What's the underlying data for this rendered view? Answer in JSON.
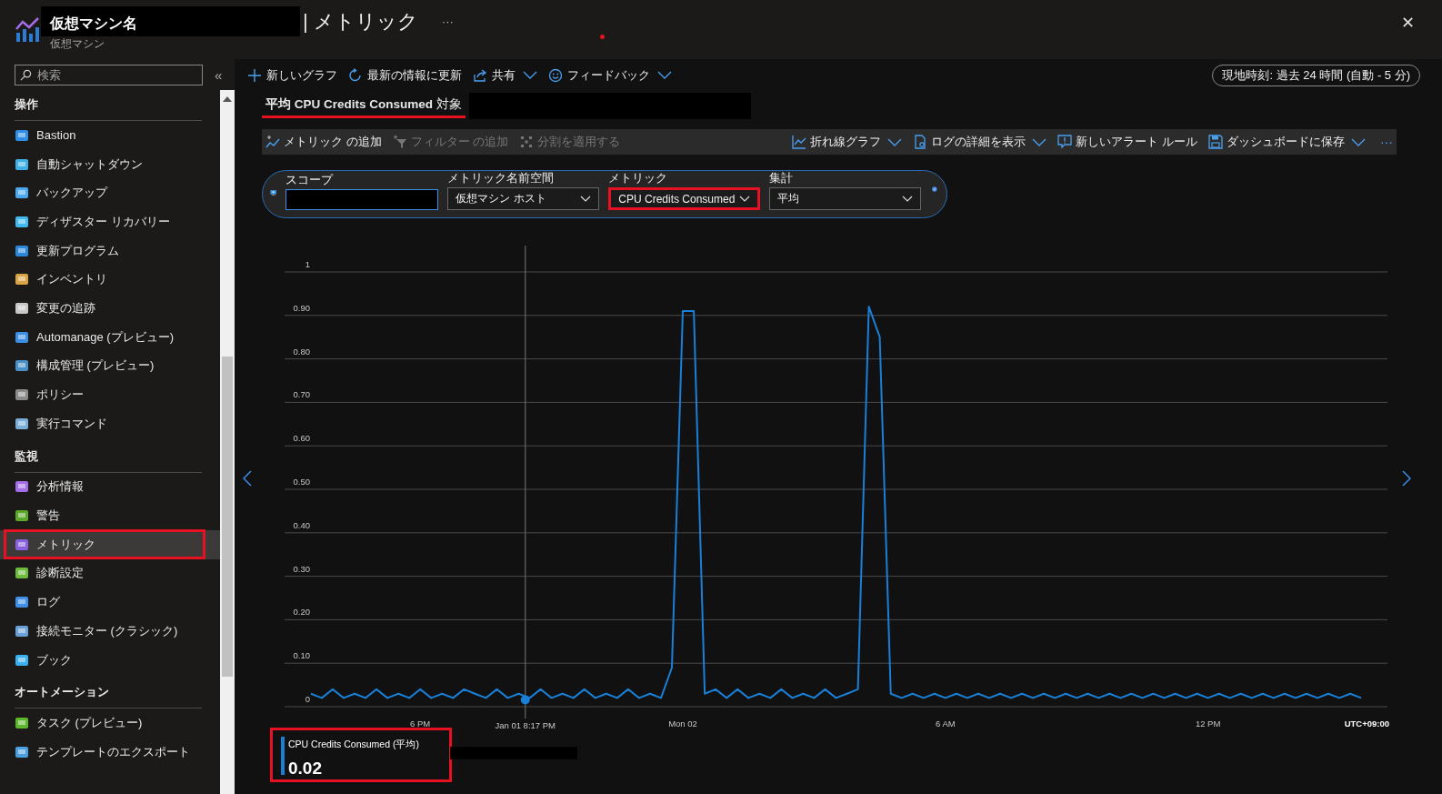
{
  "header": {
    "title": "仮想マシン名",
    "page": "| メトリック",
    "more": "···",
    "subtitle": "仮想マシン",
    "close": "✕"
  },
  "sidebar": {
    "search": {
      "placeholder": "検索"
    },
    "collapse": "«",
    "sections": [
      {
        "title": "操作",
        "items": [
          {
            "label": "Bastion",
            "selected": false
          },
          {
            "label": "自動シャットダウン",
            "selected": false
          },
          {
            "label": "バックアップ",
            "selected": false
          },
          {
            "label": "ディザスター リカバリー",
            "selected": false
          },
          {
            "label": "更新プログラム",
            "selected": false
          },
          {
            "label": "インベントリ",
            "selected": false
          },
          {
            "label": "変更の追跡",
            "selected": false
          },
          {
            "label": "Automanage (プレビュー)",
            "selected": false
          },
          {
            "label": "構成管理 (プレビュー)",
            "selected": false
          },
          {
            "label": "ポリシー",
            "selected": false
          },
          {
            "label": "実行コマンド",
            "selected": false
          }
        ]
      },
      {
        "title": "監視",
        "items": [
          {
            "label": "分析情報",
            "selected": false
          },
          {
            "label": "警告",
            "selected": false
          },
          {
            "label": "メトリック",
            "selected": true,
            "highlighted": true
          },
          {
            "label": "診断設定",
            "selected": false
          },
          {
            "label": "ログ",
            "selected": false
          },
          {
            "label": "接続モニター (クラシック)",
            "selected": false
          },
          {
            "label": "ブック",
            "selected": false
          }
        ]
      },
      {
        "title": "オートメーション",
        "items": [
          {
            "label": "タスク (プレビュー)",
            "selected": false
          },
          {
            "label": "テンプレートのエクスポート",
            "selected": false
          }
        ]
      }
    ]
  },
  "toolbar": {
    "buttons": [
      {
        "label": "新しいグラフ",
        "dropdown": false
      },
      {
        "label": "最新の情報に更新",
        "dropdown": false
      },
      {
        "label": "共有",
        "dropdown": true
      },
      {
        "label": "フィードバック",
        "dropdown": true
      }
    ],
    "time_range": "現地時刻: 過去 24 時間 (自動 - 5 分)"
  },
  "chart_title": {
    "text": "**平均 CPU Credits Consumed** 対象",
    "underlined": true
  },
  "chart_toolbar": {
    "left": [
      {
        "label": "メトリック の追加",
        "disabled": false
      },
      {
        "label": "フィルター の追加",
        "disabled": true
      },
      {
        "label": "分割を適用する",
        "disabled": true
      }
    ],
    "right": [
      {
        "label": "折れ線グラフ",
        "dropdown": true
      },
      {
        "label": "ログの詳細を表示",
        "dropdown": true
      },
      {
        "label": "新しいアラート ルール",
        "dropdown": false
      },
      {
        "label": "ダッシュボードに保存",
        "dropdown": true
      }
    ],
    "more": "···"
  },
  "selector": {
    "scope": {
      "label": "スコープ"
    },
    "fields": [
      {
        "label": "メトリック名前空間",
        "value": "仮想マシン ホスト",
        "highlighted": false
      },
      {
        "label": "メトリック",
        "value": "CPU Credits Consumed",
        "highlighted": true
      },
      {
        "label": "集計",
        "value": "平均",
        "highlighted": false
      }
    ]
  },
  "chart": {
    "timezone": "UTC+09:00",
    "chart_data": {
      "type": "line",
      "grid": true,
      "ylim": [
        0,
        1
      ],
      "yticks": [
        {
          "value": 0,
          "label": "0"
        },
        {
          "value": 0.1,
          "label": "0.10"
        },
        {
          "value": 0.2,
          "label": "0.20"
        },
        {
          "value": 0.3,
          "label": "0.30"
        },
        {
          "value": 0.4,
          "label": "0.40"
        },
        {
          "value": 0.5,
          "label": "0.50"
        },
        {
          "value": 0.6,
          "label": "0.60"
        },
        {
          "value": 0.7,
          "label": "0.70"
        },
        {
          "value": 0.8,
          "label": "0.80"
        },
        {
          "value": 0.9,
          "label": "0.90"
        },
        {
          "value": 1,
          "label": "1"
        }
      ],
      "categories": [
        null,
        null,
        null,
        null,
        null,
        null,
        null,
        null,
        null,
        null,
        "6 PM",
        null,
        null,
        null,
        null,
        null,
        null,
        null,
        null,
        null,
        null,
        null,
        null,
        null,
        null,
        null,
        null,
        null,
        null,
        null,
        null,
        null,
        null,
        null,
        "Mon 02",
        null,
        null,
        null,
        null,
        null,
        null,
        null,
        null,
        null,
        null,
        null,
        null,
        null,
        null,
        null,
        null,
        null,
        null,
        null,
        null,
        null,
        null,
        null,
        "6 AM",
        null,
        null,
        null,
        null,
        null,
        null,
        null,
        null,
        null,
        null,
        null,
        null,
        null,
        null,
        null,
        null,
        null,
        null,
        null,
        null,
        null,
        null,
        null,
        "12 PM",
        null,
        null,
        null,
        null,
        null,
        null,
        null,
        null,
        null,
        null,
        null,
        null,
        null,
        null
      ],
      "series": [
        {
          "name": "CPU Credits Consumed (平均)",
          "color": "#1a7fd6",
          "values": [
            0.03,
            0.02,
            0.04,
            0.02,
            0.03,
            0.02,
            0.04,
            0.02,
            0.03,
            0.02,
            0.04,
            0.02,
            0.03,
            0.02,
            0.04,
            0.03,
            0.02,
            0.04,
            0.02,
            0.03,
            0.02,
            0.04,
            0.02,
            0.03,
            0.02,
            0.04,
            0.02,
            0.03,
            0.02,
            0.04,
            0.02,
            0.03,
            0.02,
            0.09,
            0.91,
            0.91,
            0.03,
            0.04,
            0.02,
            0.04,
            0.02,
            0.03,
            0.02,
            0.04,
            0.02,
            0.03,
            0.02,
            0.04,
            0.02,
            0.03,
            0.04,
            0.92,
            0.85,
            0.03,
            0.02,
            0.03,
            0.02,
            0.03,
            0.02,
            0.03,
            0.02,
            0.03,
            0.02,
            0.03,
            0.02,
            0.03,
            0.02,
            0.03,
            0.02,
            0.03,
            0.02,
            0.03,
            0.02,
            0.03,
            0.02,
            0.03,
            0.02,
            0.03,
            0.02,
            0.03,
            0.02,
            0.03,
            0.02,
            0.03,
            0.02,
            0.03,
            0.02,
            0.03,
            0.02,
            0.03,
            0.02,
            0.03,
            0.02,
            0.03,
            0.02,
            0.03,
            0.02
          ]
        }
      ],
      "annotations": [
        "Jan 01 8:17 PM"
      ]
    }
  },
  "legend": {
    "value": "0.02",
    "highlighted": true
  }
}
